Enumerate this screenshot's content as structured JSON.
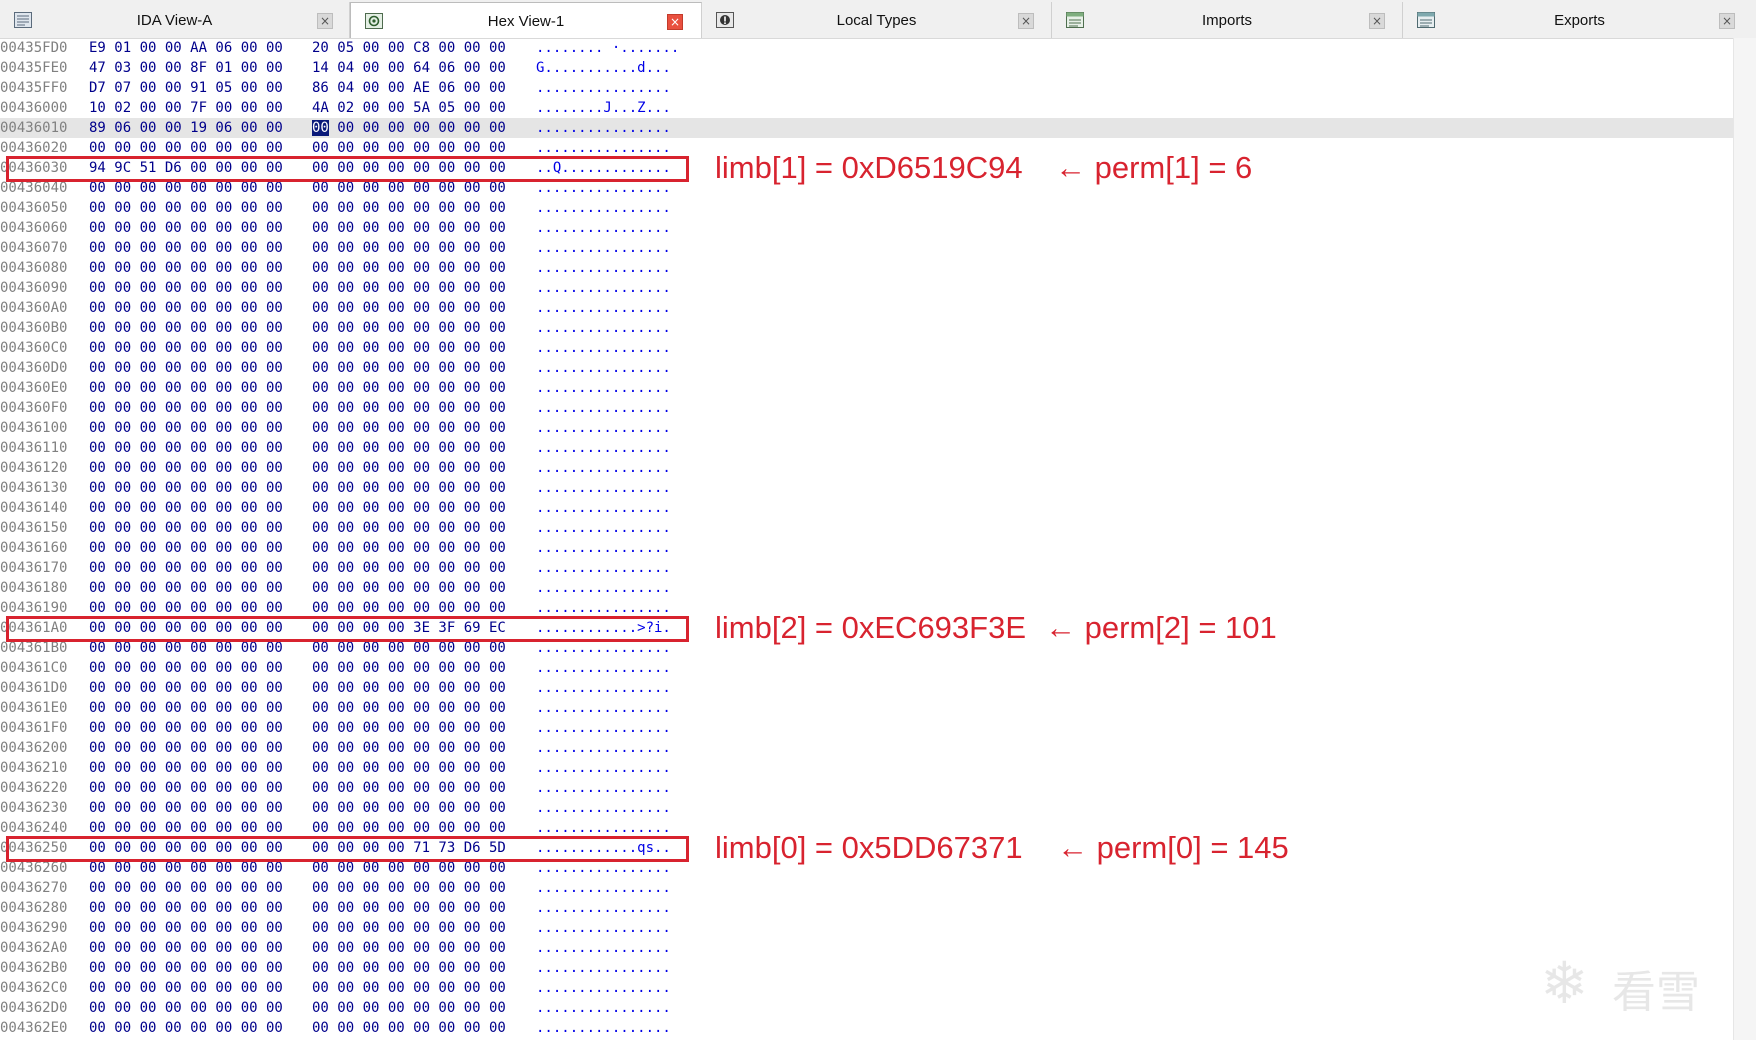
{
  "tabs": [
    {
      "label": "IDA View-A",
      "icon": "text-view-icon"
    },
    {
      "label": "Hex View-1",
      "icon": "hex-view-icon"
    },
    {
      "label": "Local Types",
      "icon": "local-types-icon"
    },
    {
      "label": "Imports",
      "icon": "imports-icon"
    },
    {
      "label": "Exports",
      "icon": "exports-icon"
    }
  ],
  "tab_close_glyph": "×",
  "rows": [
    {
      "addr": "00435FD0",
      "b1": "E9 01 00 00 AA 06 00 00",
      "b2": "20 05 00 00 C8 00 00 00",
      "ascii": "........ ·......."
    },
    {
      "addr": "00435FE0",
      "b1": "47 03 00 00 8F 01 00 00",
      "b2": "14 04 00 00 64 06 00 00",
      "ascii": "G...........d..."
    },
    {
      "addr": "00435FF0",
      "b1": "D7 07 00 00 91 05 00 00",
      "b2": "86 04 00 00 AE 06 00 00",
      "ascii": "................"
    },
    {
      "addr": "00436000",
      "b1": "10 02 00 00 7F 00 00 00",
      "b2": "4A 02 00 00 5A 05 00 00",
      "ascii": "........J...Z..."
    },
    {
      "addr": "00436010",
      "b1": "89 06 00 00 19 06 00 00",
      "b2_cursor": "00",
      "b2": " 00 00 00 00 00 00 00",
      "ascii": "................"
    },
    {
      "addr": "00436020",
      "b1": "00 00 00 00 00 00 00 00",
      "b2": "00 00 00 00 00 00 00 00",
      "ascii": "................"
    },
    {
      "addr": "00436030",
      "b1": "94 9C 51 D6 00 00 00 00",
      "b2": "00 00 00 00 00 00 00 00",
      "ascii": "..Q............."
    },
    {
      "addr": "00436040",
      "b1": "00 00 00 00 00 00 00 00",
      "b2": "00 00 00 00 00 00 00 00",
      "ascii": "................"
    },
    {
      "addr": "00436050",
      "b1": "00 00 00 00 00 00 00 00",
      "b2": "00 00 00 00 00 00 00 00",
      "ascii": "................"
    },
    {
      "addr": "00436060",
      "b1": "00 00 00 00 00 00 00 00",
      "b2": "00 00 00 00 00 00 00 00",
      "ascii": "................"
    },
    {
      "addr": "00436070",
      "b1": "00 00 00 00 00 00 00 00",
      "b2": "00 00 00 00 00 00 00 00",
      "ascii": "................"
    },
    {
      "addr": "00436080",
      "b1": "00 00 00 00 00 00 00 00",
      "b2": "00 00 00 00 00 00 00 00",
      "ascii": "................"
    },
    {
      "addr": "00436090",
      "b1": "00 00 00 00 00 00 00 00",
      "b2": "00 00 00 00 00 00 00 00",
      "ascii": "................"
    },
    {
      "addr": "004360A0",
      "b1": "00 00 00 00 00 00 00 00",
      "b2": "00 00 00 00 00 00 00 00",
      "ascii": "................"
    },
    {
      "addr": "004360B0",
      "b1": "00 00 00 00 00 00 00 00",
      "b2": "00 00 00 00 00 00 00 00",
      "ascii": "................"
    },
    {
      "addr": "004360C0",
      "b1": "00 00 00 00 00 00 00 00",
      "b2": "00 00 00 00 00 00 00 00",
      "ascii": "................"
    },
    {
      "addr": "004360D0",
      "b1": "00 00 00 00 00 00 00 00",
      "b2": "00 00 00 00 00 00 00 00",
      "ascii": "................"
    },
    {
      "addr": "004360E0",
      "b1": "00 00 00 00 00 00 00 00",
      "b2": "00 00 00 00 00 00 00 00",
      "ascii": "................"
    },
    {
      "addr": "004360F0",
      "b1": "00 00 00 00 00 00 00 00",
      "b2": "00 00 00 00 00 00 00 00",
      "ascii": "................"
    },
    {
      "addr": "00436100",
      "b1": "00 00 00 00 00 00 00 00",
      "b2": "00 00 00 00 00 00 00 00",
      "ascii": "................"
    },
    {
      "addr": "00436110",
      "b1": "00 00 00 00 00 00 00 00",
      "b2": "00 00 00 00 00 00 00 00",
      "ascii": "................"
    },
    {
      "addr": "00436120",
      "b1": "00 00 00 00 00 00 00 00",
      "b2": "00 00 00 00 00 00 00 00",
      "ascii": "................"
    },
    {
      "addr": "00436130",
      "b1": "00 00 00 00 00 00 00 00",
      "b2": "00 00 00 00 00 00 00 00",
      "ascii": "................"
    },
    {
      "addr": "00436140",
      "b1": "00 00 00 00 00 00 00 00",
      "b2": "00 00 00 00 00 00 00 00",
      "ascii": "................"
    },
    {
      "addr": "00436150",
      "b1": "00 00 00 00 00 00 00 00",
      "b2": "00 00 00 00 00 00 00 00",
      "ascii": "................"
    },
    {
      "addr": "00436160",
      "b1": "00 00 00 00 00 00 00 00",
      "b2": "00 00 00 00 00 00 00 00",
      "ascii": "................"
    },
    {
      "addr": "00436170",
      "b1": "00 00 00 00 00 00 00 00",
      "b2": "00 00 00 00 00 00 00 00",
      "ascii": "................"
    },
    {
      "addr": "00436180",
      "b1": "00 00 00 00 00 00 00 00",
      "b2": "00 00 00 00 00 00 00 00",
      "ascii": "................"
    },
    {
      "addr": "00436190",
      "b1": "00 00 00 00 00 00 00 00",
      "b2": "00 00 00 00 00 00 00 00",
      "ascii": "................"
    },
    {
      "addr": "004361A0",
      "b1": "00 00 00 00 00 00 00 00",
      "b2": "00 00 00 00 3E 3F 69 EC",
      "ascii": "............>?i."
    },
    {
      "addr": "004361B0",
      "b1": "00 00 00 00 00 00 00 00",
      "b2": "00 00 00 00 00 00 00 00",
      "ascii": "................"
    },
    {
      "addr": "004361C0",
      "b1": "00 00 00 00 00 00 00 00",
      "b2": "00 00 00 00 00 00 00 00",
      "ascii": "................"
    },
    {
      "addr": "004361D0",
      "b1": "00 00 00 00 00 00 00 00",
      "b2": "00 00 00 00 00 00 00 00",
      "ascii": "................"
    },
    {
      "addr": "004361E0",
      "b1": "00 00 00 00 00 00 00 00",
      "b2": "00 00 00 00 00 00 00 00",
      "ascii": "................"
    },
    {
      "addr": "004361F0",
      "b1": "00 00 00 00 00 00 00 00",
      "b2": "00 00 00 00 00 00 00 00",
      "ascii": "................"
    },
    {
      "addr": "00436200",
      "b1": "00 00 00 00 00 00 00 00",
      "b2": "00 00 00 00 00 00 00 00",
      "ascii": "................"
    },
    {
      "addr": "00436210",
      "b1": "00 00 00 00 00 00 00 00",
      "b2": "00 00 00 00 00 00 00 00",
      "ascii": "................"
    },
    {
      "addr": "00436220",
      "b1": "00 00 00 00 00 00 00 00",
      "b2": "00 00 00 00 00 00 00 00",
      "ascii": "................"
    },
    {
      "addr": "00436230",
      "b1": "00 00 00 00 00 00 00 00",
      "b2": "00 00 00 00 00 00 00 00",
      "ascii": "................"
    },
    {
      "addr": "00436240",
      "b1": "00 00 00 00 00 00 00 00",
      "b2": "00 00 00 00 00 00 00 00",
      "ascii": "................"
    },
    {
      "addr": "00436250",
      "b1": "00 00 00 00 00 00 00 00",
      "b2": "00 00 00 00 71 73 D6 5D",
      "ascii": "............qs.."
    },
    {
      "addr": "00436260",
      "b1": "00 00 00 00 00 00 00 00",
      "b2": "00 00 00 00 00 00 00 00",
      "ascii": "................"
    },
    {
      "addr": "00436270",
      "b1": "00 00 00 00 00 00 00 00",
      "b2": "00 00 00 00 00 00 00 00",
      "ascii": "................"
    },
    {
      "addr": "00436280",
      "b1": "00 00 00 00 00 00 00 00",
      "b2": "00 00 00 00 00 00 00 00",
      "ascii": "................"
    },
    {
      "addr": "00436290",
      "b1": "00 00 00 00 00 00 00 00",
      "b2": "00 00 00 00 00 00 00 00",
      "ascii": "................"
    },
    {
      "addr": "004362A0",
      "b1": "00 00 00 00 00 00 00 00",
      "b2": "00 00 00 00 00 00 00 00",
      "ascii": "................"
    },
    {
      "addr": "004362B0",
      "b1": "00 00 00 00 00 00 00 00",
      "b2": "00 00 00 00 00 00 00 00",
      "ascii": "................"
    },
    {
      "addr": "004362C0",
      "b1": "00 00 00 00 00 00 00 00",
      "b2": "00 00 00 00 00 00 00 00",
      "ascii": "................"
    },
    {
      "addr": "004362D0",
      "b1": "00 00 00 00 00 00 00 00",
      "b2": "00 00 00 00 00 00 00 00",
      "ascii": "................"
    },
    {
      "addr": "004362E0",
      "b1": "00 00 00 00 00 00 00 00",
      "b2": "00 00 00 00 00 00 00 00",
      "ascii": "................"
    }
  ],
  "annotations": [
    {
      "limb": "limb[1] = 0xD6519C94",
      "perm": "← perm[1] = 6"
    },
    {
      "limb": "limb[2] = 0xEC693F3E",
      "perm": "← perm[2] = 101"
    },
    {
      "limb": "limb[0] = 0x5DD67371",
      "perm": "← perm[0] = 145"
    }
  ],
  "watermark": {
    "text": "看雪",
    "icon": "snowflake-icon"
  },
  "colors": {
    "annotation": "#d8232f",
    "hex_bytes": "#00008b",
    "ascii": "#0000e6",
    "address": "#808080",
    "cursor": "#0a1a7a"
  }
}
